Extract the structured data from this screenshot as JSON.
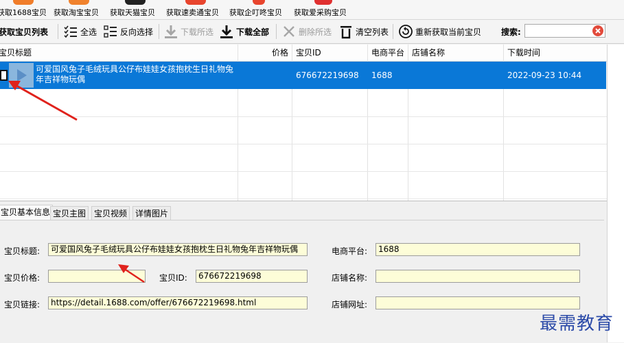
{
  "source_bar": {
    "buttons": [
      {
        "label": "获取1688宝贝",
        "color": "#f07d2a"
      },
      {
        "label": "获取淘宝宝贝",
        "color": "#f0822d"
      },
      {
        "label": "获取天猫宝贝",
        "color": "#222222"
      },
      {
        "label": "获取速卖通宝贝",
        "color": "#e8452e"
      },
      {
        "label": "获取企叮咚宝贝",
        "color": "#e8452e"
      },
      {
        "label": "获取爱采购宝贝",
        "color": "#e03030"
      }
    ]
  },
  "toolbar": {
    "get_list": "获取宝贝列表",
    "select_all": "全选",
    "invert": "反向选择",
    "download_selected": "下载所选",
    "download_all": "下载全部",
    "delete_selected": "删除所选",
    "clear_list": "清空列表",
    "refetch": "重新获取当前宝贝",
    "search_label": "搜索:",
    "search_value": ""
  },
  "table": {
    "columns": [
      "宝贝标题",
      "价格",
      "宝贝ID",
      "电商平台",
      "店铺名称",
      "下载时间"
    ],
    "rows": [
      {
        "title_line1": "可爱国风兔子毛绒玩具公仔布娃娃女孩抱枕生日礼物兔",
        "title_line2": "年吉祥物玩偶",
        "price": "",
        "id": "676672219698",
        "platform": "1688",
        "shop": "",
        "time": "2022-09-23 10:44"
      }
    ]
  },
  "tabs": [
    "宝贝基本信息",
    "宝贝主图",
    "宝贝视频",
    "详情图片"
  ],
  "form": {
    "title_label": "宝贝标题:",
    "title_value": "可爱国风兔子毛绒玩具公仔布娃娃女孩抱枕生日礼物兔年吉祥物玩偶",
    "price_label": "宝贝价格:",
    "price_value": "",
    "id_label": "宝贝ID:",
    "id_value": "676672219698",
    "link_label": "宝贝链接:",
    "link_value": "https://detail.1688.com/offer/676672219698.html",
    "platform_label": "电商平台:",
    "platform_value": "1688",
    "shop_label": "店铺名称:",
    "shop_value": "",
    "shop_url_label": "店铺网址:",
    "shop_url_value": ""
  },
  "watermark": "最需教育",
  "colors": {
    "selection": "#0a78d7",
    "field_bg": "#fdfdd8",
    "arrow": "#e0221c"
  }
}
